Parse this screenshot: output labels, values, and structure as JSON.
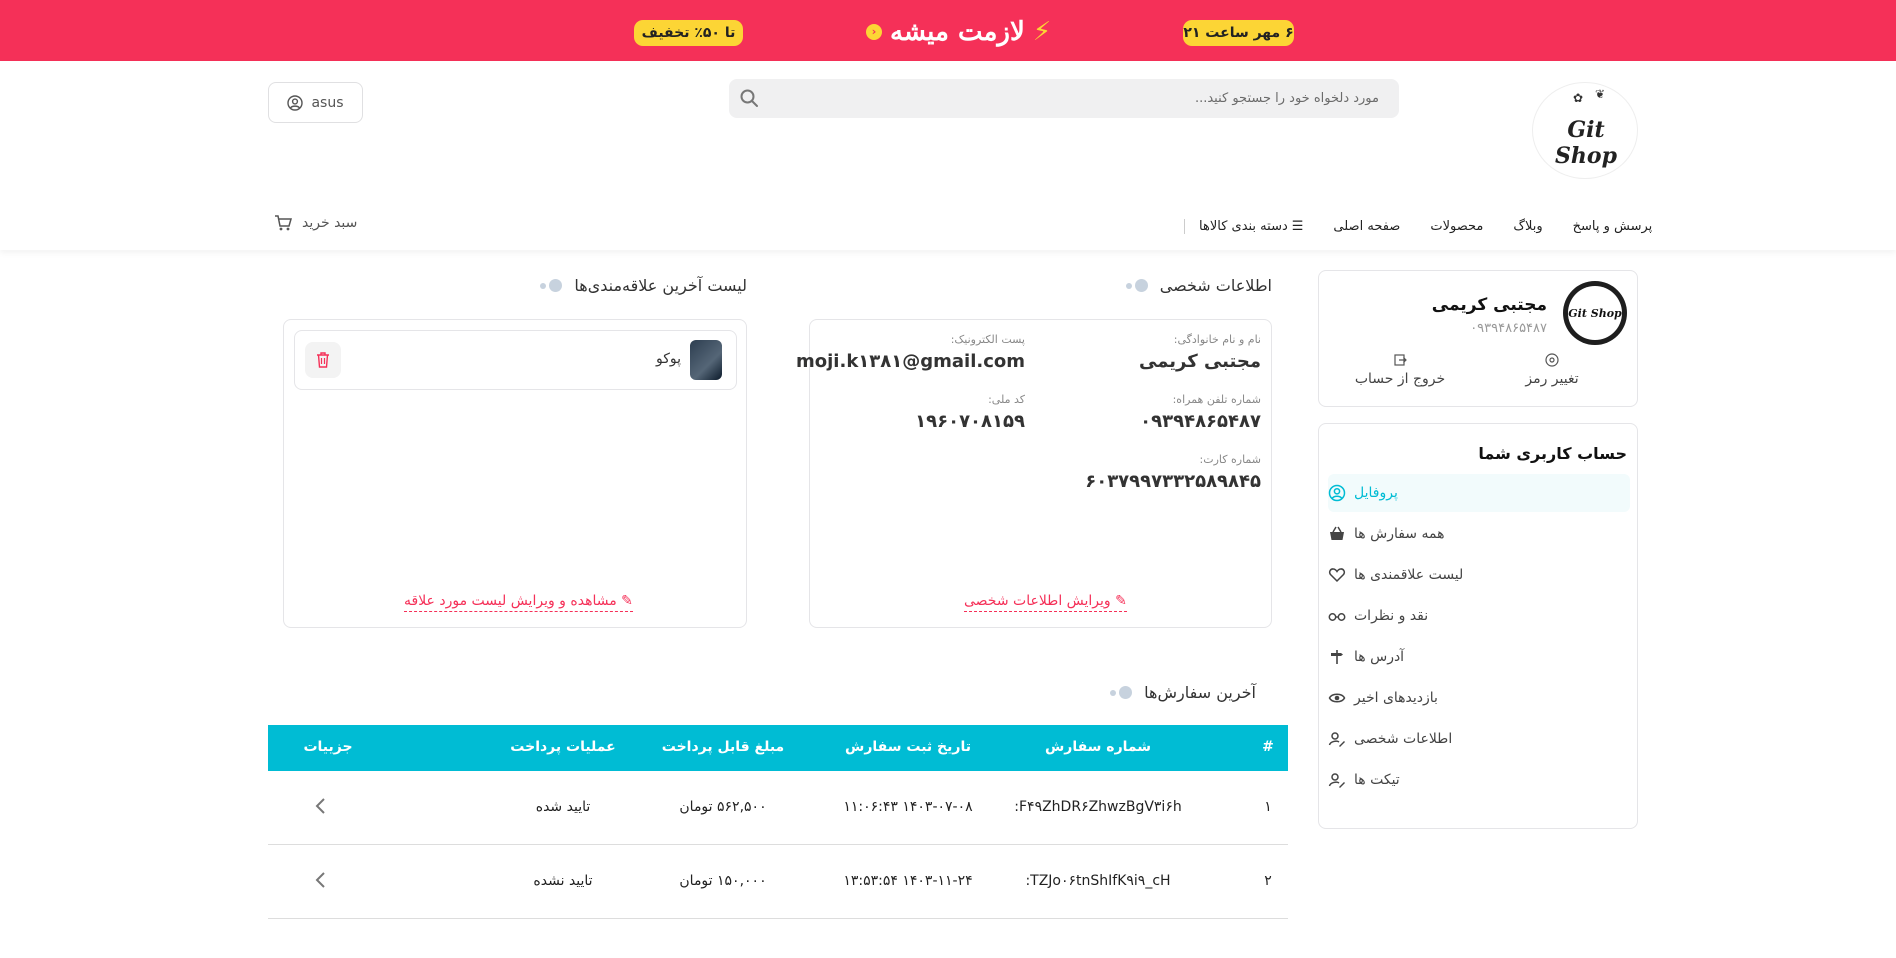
{
  "promo": {
    "discount": "تا ۵۰٪ تخفیف",
    "headline": "لازمت میشه",
    "date": "۶ مهر ساعت ۲۱"
  },
  "header": {
    "logo_text": "Git Shop",
    "search_placeholder": "مورد دلخواه خود را جستجو کنید...",
    "user_label": "asus",
    "cart_label": "سبد خرید",
    "nav": {
      "categories": "دسته بندی کالاها",
      "home": "صفحه اصلی",
      "products": "محصولات",
      "blog": "وبلاگ",
      "faq": "پرسش و پاسخ"
    }
  },
  "profile": {
    "avatar_text": "Git Shop",
    "name": "مجتبی کریمی",
    "phone": "۰۹۳۹۴۸۶۵۴۸۷",
    "change_password": "تغییر رمز",
    "logout": "خروج از حساب"
  },
  "menu": {
    "title": "حساب کاربری شما",
    "items": [
      {
        "label": "پروفایل",
        "icon": "user-circle-icon",
        "active": true
      },
      {
        "label": "همه سفارش ها",
        "icon": "basket-icon",
        "active": false
      },
      {
        "label": "لیست علاقمندی ها",
        "icon": "heart-icon",
        "active": false
      },
      {
        "label": "نقد و نظرات",
        "icon": "glasses-icon",
        "active": false
      },
      {
        "label": "آدرس ها",
        "icon": "signpost-icon",
        "active": false
      },
      {
        "label": "بازدیدهای اخیر",
        "icon": "eye-icon",
        "active": false
      },
      {
        "label": "اطلاعات شخصی",
        "icon": "user-edit-icon",
        "active": false
      },
      {
        "label": "تیکت ها",
        "icon": "user-edit-icon",
        "active": false
      }
    ]
  },
  "personal": {
    "title": "اطلاعات شخصی",
    "name_label": "نام و نام خانوادگی:",
    "name_value": "مجتبی کریمی",
    "email_label": "پست الکترونیک:",
    "email_value": "moji.k۱۳۸۱@gmail.com",
    "phone_label": "شماره تلفن همراه:",
    "phone_value": "۰۹۳۹۴۸۶۵۴۸۷",
    "national_label": "کد ملی:",
    "national_value": "۱۹۶۰۷۰۸۱۵۹",
    "card_label": "شماره کارت:",
    "card_value": "۶۰۳۷۹۹۷۳۳۲۵۸۹۸۴۵",
    "edit_link": "ویرایش اطلاعات شخصی"
  },
  "favorites": {
    "title": "لیست آخرین علاقه‌مندی‌ها",
    "items": [
      {
        "name": "پوکو"
      }
    ],
    "edit_link": "مشاهده و ویرایش لیست مورد علاقه"
  },
  "orders": {
    "title": "آخرین سفارش‌ها",
    "columns": [
      "#",
      "شماره سفارش",
      "تاریخ ثبت سفارش",
      "مبلغ قابل پرداخت",
      "عملیات پرداخت",
      "جزییات"
    ],
    "rows": [
      {
        "num": "۱",
        "id": "F۴۹ZhDR۶ZhwzBgV۳i۶h:",
        "date": "۱۴۰۳-۰۷-۰۸ ۱۱:۰۶:۴۳",
        "amount": "۵۶۲,۵۰۰ تومان",
        "status": "تایید شده"
      },
      {
        "num": "۲",
        "id": "TZJo۰۶tnShIfK۹i۹_cH:",
        "date": "۱۴۰۳-۱۱-۲۴ ۱۳:۵۳:۵۴",
        "amount": "۱۵۰,۰۰۰ تومان",
        "status": "تایید نشده"
      }
    ]
  },
  "colors": {
    "brand_red": "#f53058",
    "accent_cyan": "#00bcd4",
    "promo_yellow": "#fcd535"
  }
}
